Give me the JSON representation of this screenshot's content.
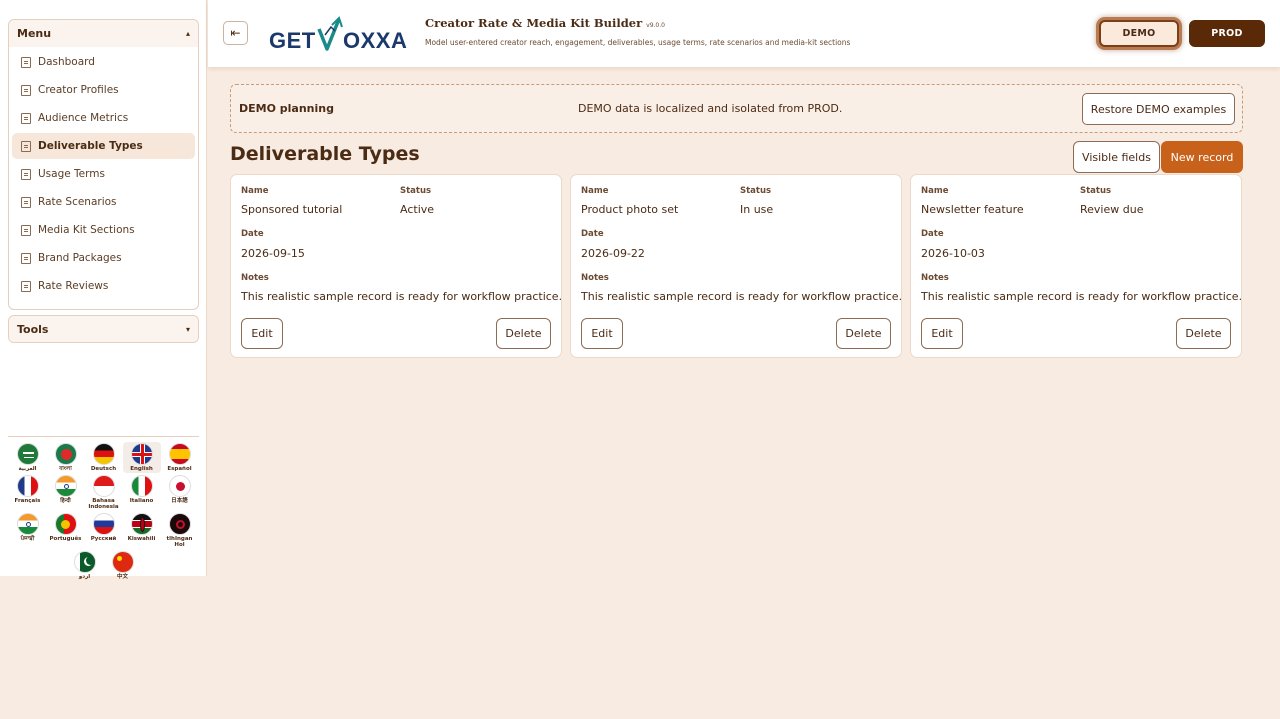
{
  "sidebar": {
    "menu_title": "Menu",
    "menu_caret": "▴",
    "items": [
      {
        "label": "Dashboard"
      },
      {
        "label": "Creator Profiles"
      },
      {
        "label": "Audience Metrics"
      },
      {
        "label": "Deliverable Types",
        "active": true
      },
      {
        "label": "Usage Terms"
      },
      {
        "label": "Rate Scenarios"
      },
      {
        "label": "Media Kit Sections"
      },
      {
        "label": "Brand Packages"
      },
      {
        "label": "Rate Reviews"
      }
    ],
    "tools_title": "Tools",
    "tools_caret": "▾",
    "languages": [
      {
        "name": "العربية"
      },
      {
        "name": "বাংলা"
      },
      {
        "name": "Deutsch"
      },
      {
        "name": "English",
        "selected": true
      },
      {
        "name": "Español"
      },
      {
        "name": "Français"
      },
      {
        "name": "हिन्दी"
      },
      {
        "name": "Bahasa Indonesia"
      },
      {
        "name": "Italiano"
      },
      {
        "name": "日本語"
      },
      {
        "name": "ਪੰਜਾਬੀ"
      },
      {
        "name": "Português"
      },
      {
        "name": "Русский"
      },
      {
        "name": "Kiswahili"
      },
      {
        "name": "tlhIngan Hol"
      },
      {
        "name": "اردو"
      },
      {
        "name": "中文"
      }
    ]
  },
  "header": {
    "collapse_icon": "⇤",
    "logo_text": "GETVOXXA",
    "title": "Creator Rate & Media Kit Builder",
    "version": "v9.0.0",
    "subtitle": "Model user-entered creator reach, engagement, deliverables, usage terms, rate scenarios and media-kit sections",
    "demo_label": "DEMO",
    "prod_label": "PROD"
  },
  "banner": {
    "title": "DEMO planning",
    "message": "DEMO data is localized and isolated from PROD.",
    "restore_label": "Restore DEMO examples"
  },
  "main": {
    "page_title": "Deliverable Types",
    "visible_fields_label": "Visible fields",
    "new_record_label": "New record",
    "labels": {
      "name": "Name",
      "status": "Status",
      "date": "Date",
      "notes": "Notes"
    },
    "edit_label": "Edit",
    "delete_label": "Delete",
    "records": [
      {
        "name": "Sponsored tutorial",
        "status": "Active",
        "date": "2026-09-15",
        "notes": "This realistic sample record is ready for workflow practice."
      },
      {
        "name": "Product photo set",
        "status": "In use",
        "date": "2026-09-22",
        "notes": "This realistic sample record is ready for workflow practice."
      },
      {
        "name": "Newsletter feature",
        "status": "Review due",
        "date": "2026-10-03",
        "notes": "This realistic sample record is ready for workflow practice."
      }
    ]
  },
  "colors": {
    "accent": "#c8621b",
    "brand_dark": "#5a2a08",
    "background": "#f8ebe1",
    "logo_teal": "#1a8a8a",
    "logo_navy": "#1b3a6b"
  }
}
